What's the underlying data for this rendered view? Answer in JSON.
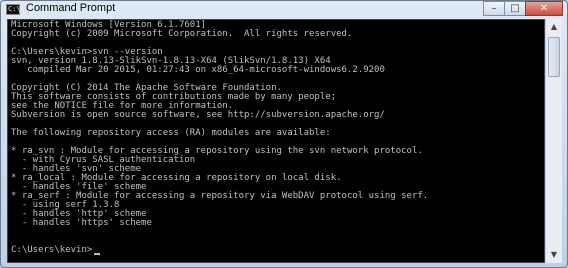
{
  "window": {
    "title": "Command Prompt",
    "icon_label": "C:\\",
    "buttons": {
      "minimize": "–",
      "maximize": "□",
      "close": "✕"
    }
  },
  "console": {
    "lines": [
      "Microsoft Windows [Version 6.1.7601]",
      "Copyright (c) 2009 Microsoft Corporation.  All rights reserved.",
      "",
      "C:\\Users\\kevin>svn --version",
      "svn, version 1.8.13-SlikSvn-1.8.13-X64 (SlikSvn/1.8.13) X64",
      "   compiled Mar 20 2015, 01:27:43 on x86_64-microsoft-windows6.2.9200",
      "",
      "Copyright (C) 2014 The Apache Software Foundation.",
      "This software consists of contributions made by many people;",
      "see the NOTICE file for more information.",
      "Subversion is open source software, see http://subversion.apache.org/",
      "",
      "The following repository access (RA) modules are available:",
      "",
      "* ra_svn : Module for accessing a repository using the svn network protocol.",
      "  - with Cyrus SASL authentication",
      "  - handles 'svn' scheme",
      "* ra_local : Module for accessing a repository on local disk.",
      "  - handles 'file' scheme",
      "* ra_serf : Module for accessing a repository via WebDAV protocol using serf.",
      "  - using serf 1.3.8",
      "  - handles 'http' scheme",
      "  - handles 'https' scheme",
      "",
      "",
      "C:\\Users\\kevin>"
    ]
  },
  "scrollbar": {
    "up": "▲",
    "down": "▼"
  }
}
